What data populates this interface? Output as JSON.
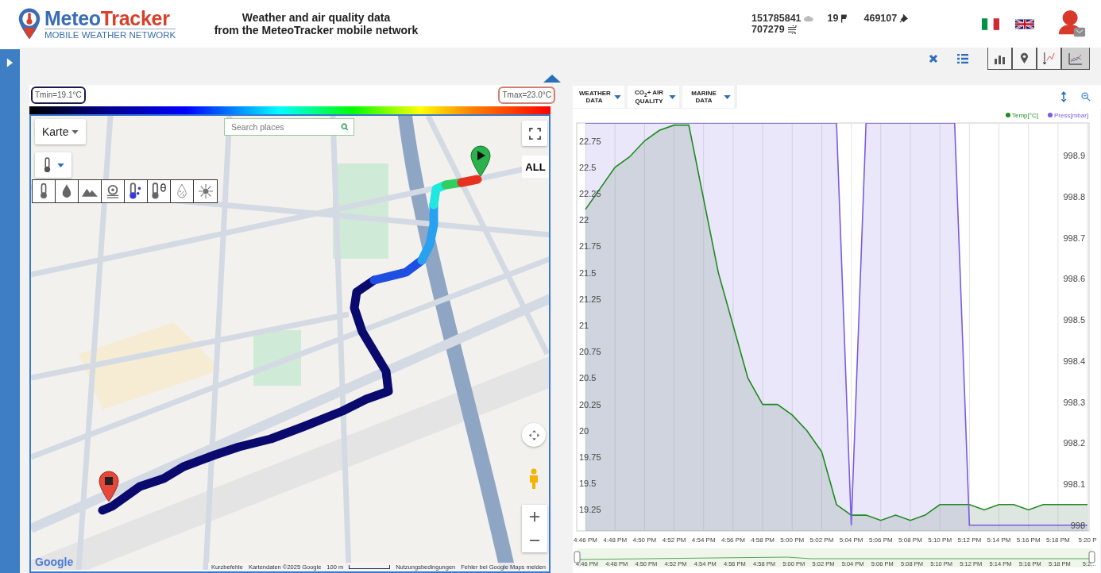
{
  "header": {
    "logo": {
      "parts": [
        {
          "text": "Meteo",
          "color": "#3a6db3"
        },
        {
          "text": "Tracker",
          "color": "#d8402c"
        }
      ],
      "subtitle": "MOBILE WEATHER NETWORK"
    },
    "tagline": [
      "Weather and air quality data",
      "from the MeteoTracker mobile network"
    ],
    "stats": [
      {
        "kind": "distance",
        "value": "151785841"
      },
      {
        "kind": "flag",
        "value": "19"
      },
      {
        "kind": "pin",
        "value": "469107"
      },
      {
        "kind": "wind",
        "value": "707279"
      }
    ],
    "languages": [
      {
        "kind": "italian",
        "selected": false
      },
      {
        "kind": "english",
        "selected": false
      }
    ]
  },
  "toolbar": {
    "actions": [
      {
        "kind": "close"
      },
      {
        "kind": "list"
      }
    ],
    "views": [
      {
        "kind": "bars",
        "selected": false
      },
      {
        "kind": "pin",
        "selected": false
      },
      {
        "kind": "profile",
        "selected": false
      },
      {
        "kind": "line",
        "selected": true
      }
    ]
  },
  "map_panel": {
    "tmin": "Tmin=19.1°C",
    "tmax": "Tmax=23.0°C",
    "map": {
      "kind": "picture",
      "type_button": "Karte",
      "search": {
        "placeholder": "Search places"
      },
      "all_button": "ALL",
      "variables": [
        {
          "kind": "temperature"
        },
        {
          "kind": "humidity"
        },
        {
          "kind": "altitude"
        },
        {
          "kind": "pressure"
        },
        {
          "kind": "dewpoint"
        },
        {
          "kind": "potential"
        },
        {
          "kind": "relative"
        },
        {
          "kind": "sun"
        }
      ],
      "google": "Google",
      "attribution": [
        "Kurzbefehle",
        "Kartendaten ©2025 Google",
        "100 m",
        "Nutzungsbedingungen",
        "Fehler bei Google Maps melden"
      ]
    }
  },
  "chart_panel": {
    "tabs": [
      {
        "label": "WEATHER DATA"
      },
      {
        "label": "CO$_{2}$+ AIR QUALITY"
      },
      {
        "label": "MARINE DATA"
      }
    ],
    "chart_data": {
      "type": "line",
      "grid": true,
      "legend": "top-right",
      "x": [
        "4:46 PM",
        null,
        "4:48 PM",
        null,
        "4:50 PM",
        null,
        "4:52 PM",
        null,
        "4:54 PM",
        null,
        "4:56 PM",
        null,
        "4:58 PM",
        null,
        "5:00 PM",
        null,
        "5:02 PM",
        null,
        "5:04 PM",
        null,
        "5:06 PM",
        null,
        "5:08 PM",
        null,
        "5:10 PM",
        null,
        "5:12 PM",
        null,
        "5:14 PM",
        null,
        "5:16 PM",
        null,
        "5:18 PM",
        null,
        "5:20 P"
      ],
      "series": [
        {
          "name": "Temp[°C]",
          "color": "#1e8a1e",
          "axis": "y",
          "values": [
            22.1,
            22.3,
            22.5,
            22.6,
            22.75,
            22.85,
            22.9,
            22.9,
            22.2,
            21.5,
            21.0,
            20.5,
            20.25,
            20.25,
            20.15,
            20.0,
            19.8,
            19.3,
            19.2,
            19.2,
            19.15,
            19.2,
            19.15,
            19.2,
            19.3,
            19.3,
            19.3,
            19.25,
            19.3,
            19.3,
            19.25,
            19.3,
            19.3,
            19.3,
            19.3
          ]
        },
        {
          "name": "Press[mbar]",
          "color": "#7a5ce0",
          "axis": "y2",
          "values": [
            998.98,
            998.98,
            998.98,
            998.98,
            998.98,
            998.98,
            998.98,
            998.98,
            998.98,
            998.98,
            998.98,
            998.98,
            998.98,
            998.98,
            998.98,
            998.98,
            998.98,
            998.98,
            998.0,
            998.98,
            998.98,
            998.98,
            998.98,
            998.98,
            998.98,
            998.98,
            998.0,
            998.0,
            998.0,
            998.0,
            998.0,
            998.0,
            998.0,
            998.0,
            998.0
          ]
        }
      ],
      "ylim": [
        19.05,
        22.92
      ],
      "yticks": [
        19.25,
        19.5,
        19.75,
        20,
        20.25,
        20.5,
        20.75,
        21,
        21.25,
        21.5,
        21.75,
        22,
        22.25,
        22.5,
        22.75
      ],
      "y2lim": [
        997.986,
        998.98
      ],
      "y2ticks": [
        998,
        998.1,
        998.2,
        998.3,
        998.4,
        998.5,
        998.6,
        998.7,
        998.8,
        998.9
      ]
    },
    "navigator_labels": [
      "4:46 PM",
      "4:48 PM",
      "4:50 PM",
      "4:52 PM",
      "4:54 PM",
      "4:56 PM",
      "4:58 PM",
      "5:00 PM",
      "5:02 PM",
      "5:04 PM",
      "5:06 PM",
      "5:08 PM",
      "5:10 PM",
      "5:12 PM",
      "5:14 PM",
      "5:16 PM",
      "5:18 PM",
      "5:2..."
    ]
  }
}
